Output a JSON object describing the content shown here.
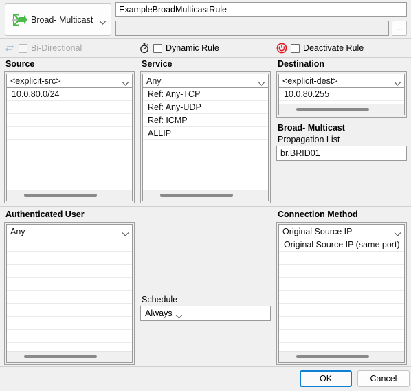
{
  "dialog": {
    "rule_type": {
      "label": "Broad- Multicast",
      "icon": "multicast-arrows-icon",
      "accent_color": "#4cbb4c"
    },
    "rule_name": {
      "value": "ExampleBroadMulticastRule",
      "placeholder": ""
    },
    "rule_comment": {
      "value": "",
      "placeholder": ""
    },
    "browse_button": {
      "label": "...",
      "icon": "ellipsis-icon"
    }
  },
  "options": [
    {
      "id": "bi-directional",
      "label": "Bi-Directional",
      "icon": "bidirectional-arrows-icon",
      "checked": false,
      "disabled": true,
      "icon_color": "#a9c3d6"
    },
    {
      "id": "dynamic-rule",
      "label": "Dynamic Rule",
      "icon": "stopwatch-icon",
      "checked": false,
      "disabled": false,
      "icon_color": "#222222"
    },
    {
      "id": "deactivate-rule",
      "label": "Deactivate Rule",
      "icon": "power-icon",
      "checked": false,
      "disabled": false,
      "icon_color": "#e01b24"
    }
  ],
  "source": {
    "title": "Source",
    "selector_value": "<explicit-src>",
    "items": [
      "10.0.80.0/24"
    ],
    "empty_rows": 8,
    "has_hscroll": true
  },
  "service": {
    "title": "Service",
    "selector_value": "Any",
    "items": [
      "Ref: Any-TCP",
      "Ref: Any-UDP",
      "Ref: ICMP",
      "ALLIP"
    ],
    "empty_rows": 5,
    "has_hscroll": true
  },
  "destination": {
    "title": "Destination",
    "selector_value": "<explicit-dest>",
    "items": [
      "10.0.80.255"
    ],
    "empty_rows": 1,
    "has_hscroll": true
  },
  "propagation": {
    "section_title": "Broad- Multicast",
    "label": "Propagation List",
    "value": "br.BRID01",
    "placeholder": ""
  },
  "authenticated_user": {
    "title": "Authenticated User",
    "selector_value": "Any",
    "items": [],
    "empty_rows": 10,
    "has_hscroll": true
  },
  "schedule": {
    "label": "Schedule",
    "selector_value": "Always"
  },
  "connection_method": {
    "title": "Connection Method",
    "selector_value": "Original Source IP",
    "items": [
      "Original Source IP (same port)"
    ],
    "empty_rows": 9,
    "has_hscroll": true
  },
  "footer": {
    "ok_label": "OK",
    "cancel_label": "Cancel"
  }
}
